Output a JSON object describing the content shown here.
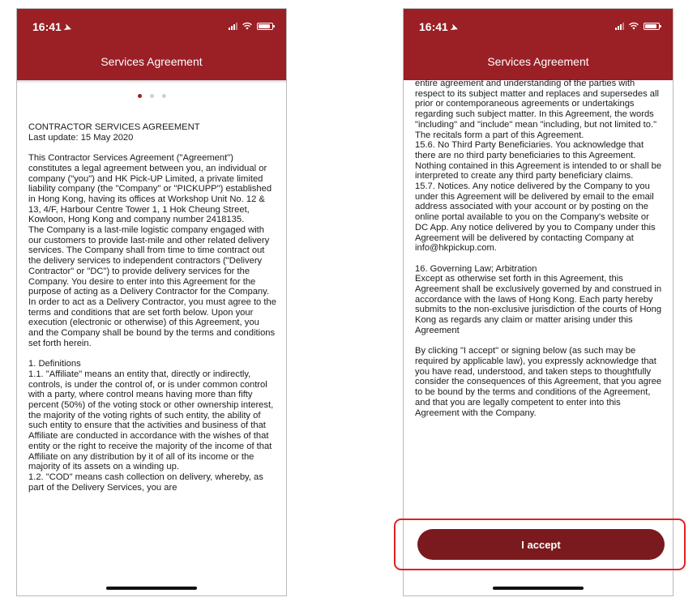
{
  "status_bar": {
    "time": "16:41"
  },
  "screen_title": "Services Agreement",
  "pager": {
    "count": 3,
    "active": 0
  },
  "left_screen": {
    "text": "CONTRACTOR SERVICES AGREEMENT\nLast update: 15 May 2020\n\nThis Contractor Services Agreement (\"Agreement\") constitutes a legal agreement between you, an individual or company (\"you\") and HK Pick-UP Limited, a private limited liability company (the \"Company\" or \"PICKUPP\") established in Hong Kong, having its offices at Workshop Unit No. 12 & 13, 4/F, Harbour Centre Tower 1, 1 Hok Cheung Street, Kowloon, Hong Kong and company number 2418135.\nThe Company is a last-mile logistic company engaged with our customers to provide last-mile and other related delivery services. The Company shall from time to time contract out the delivery services to independent contractors (\"Delivery Contractor\" or \"DC\") to provide delivery services for the Company. You desire to enter into this Agreement for the purpose of acting as a Delivery Contractor for the Company. In order to act as a Delivery Contractor, you must agree to the terms and conditions that are set forth below. Upon your execution (electronic or otherwise) of this Agreement, you and the Company shall be bound by the terms and conditions set forth herein.\n\n1.      Definitions\n1.1.      \"Affiliate\" means an entity that, directly or indirectly, controls, is under the control of, or is under common control with a party, where control means having more than fifty percent (50%) of the voting stock or other ownership interest, the majority of the voting rights of such entity, the ability of such entity to ensure that the activities and business of that Affiliate are conducted in accordance with the wishes of that entity or the right to receive the majority of the income of that Affiliate on any distribution by it of all of its income or the majority of its assets on a winding up.\n1.2.      \"COD\" means cash collection on delivery, whereby, as part of the Delivery Services, you are"
  },
  "right_screen": {
    "text": "entire agreement and understanding of the parties with respect to its subject matter and replaces and supersedes all prior or contemporaneous agreements or undertakings regarding such subject matter. In this Agreement, the words \"including\" and \"include\" mean \"including, but not limited to.\" The recitals form a part of this Agreement.\n15.6.      No Third Party Beneficiaries. You acknowledge that there are no third party beneficiaries to this Agreement. Nothing contained in this Agreement is intended to or shall be interpreted to create any third party beneficiary claims.\n15.7.      Notices. Any notice delivered by the Company to you under this Agreement will be delivered by email to the email address associated with your account or by posting on the online portal available to you on the Company's website or DC App. Any notice delivered by you to Company under this Agreement will be delivered by contacting Company at info@hkpickup.com.\n\n16.      Governing Law; Arbitration\nExcept as otherwise set forth in this Agreement, this Agreement shall be exclusively governed by and construed in accordance with the laws of Hong Kong. Each party hereby submits to the non-exclusive jurisdiction of the courts of Hong Kong as regards any claim or matter arising under this Agreement\n\nBy clicking \"I accept\" or signing below (as such may be required by applicable law), you expressly acknowledge that you have read, understood, and taken steps to thoughtfully consider the consequences of this Agreement, that you agree to be bound by the terms and conditions of the Agreement, and that you are legally competent to enter into this Agreement with the Company.",
    "accept_label": "I accept"
  },
  "colors": {
    "brand": "#9a2025",
    "button": "#7a1a1e",
    "highlight": "#e02020"
  },
  "icons": [
    "location-arrow-icon",
    "signal-icon",
    "wifi-icon",
    "battery-icon"
  ]
}
